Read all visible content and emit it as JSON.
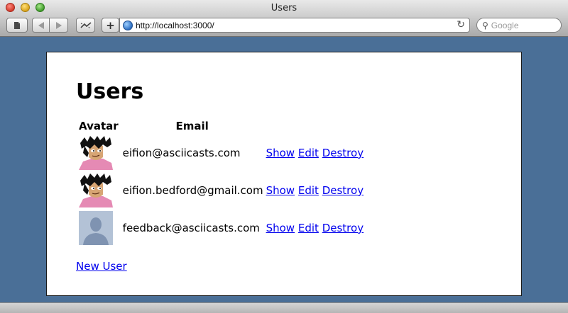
{
  "window": {
    "title": "Users"
  },
  "toolbar": {
    "url": "http://localhost:3000/",
    "search_placeholder": "Google",
    "add_label": "+"
  },
  "page": {
    "heading": "Users",
    "columns": [
      "Avatar",
      "Email"
    ],
    "users": [
      {
        "email": "eifion@asciicasts.com",
        "avatar": "cartoon-avatar",
        "show": "Show",
        "edit": "Edit",
        "destroy": "Destroy"
      },
      {
        "email": "eifion.bedford@gmail.com",
        "avatar": "cartoon-avatar",
        "show": "Show",
        "edit": "Edit",
        "destroy": "Destroy"
      },
      {
        "email": "feedback@asciicasts.com",
        "avatar": "default-avatar",
        "show": "Show",
        "edit": "Edit",
        "destroy": "Destroy"
      }
    ],
    "new_user_link": "New User"
  },
  "colors": {
    "background": "#4a6f97",
    "link": "#0000ee"
  }
}
